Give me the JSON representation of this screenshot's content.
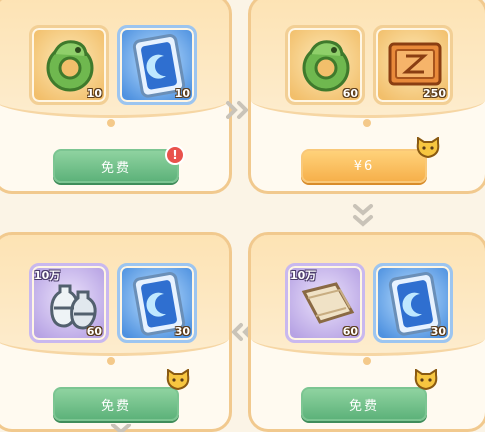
{
  "packs": [
    {
      "items": [
        {
          "icon": "jade-dragon-icon",
          "qty": "10",
          "tag": ""
        },
        {
          "icon": "blue-card-icon",
          "qty": "10",
          "tag": ""
        }
      ],
      "button": "免费",
      "notice": "!"
    },
    {
      "items": [
        {
          "icon": "jade-dragon-icon",
          "qty": "60",
          "tag": ""
        },
        {
          "icon": "orange-scroll-icon",
          "qty": "250",
          "tag": ""
        }
      ],
      "button": "¥6",
      "notice": ""
    },
    {
      "items": [
        {
          "icon": "porcelain-vase-icon",
          "qty": "60",
          "tag": "10万"
        },
        {
          "icon": "blue-card-icon",
          "qty": "30",
          "tag": ""
        }
      ],
      "button": "免费",
      "notice": ""
    },
    {
      "items": [
        {
          "icon": "paper-scroll-icon",
          "qty": "60",
          "tag": "10万"
        },
        {
          "icon": "blue-card-icon",
          "qty": "30",
          "tag": ""
        }
      ],
      "button": "免费",
      "notice": ""
    }
  ]
}
